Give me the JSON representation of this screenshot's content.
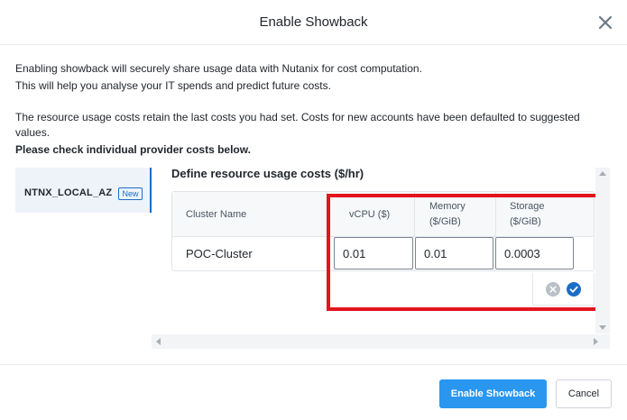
{
  "dialog": {
    "title": "Enable Showback",
    "close_icon": "close-icon"
  },
  "description": {
    "line1": "Enabling showback will securely share usage data with Nutanix for cost computation.",
    "line2": "This will help you analyse your IT spends and predict future costs.",
    "line3": "The resource usage costs retain the last costs you had set. Costs for new accounts have been defaulted to suggested",
    "line4": "values.",
    "line5": "Please check individual provider costs below."
  },
  "providers": [
    {
      "name": "NTNX_LOCAL_AZ",
      "badge": "New",
      "selected": true
    }
  ],
  "costs": {
    "heading": "Define resource usage costs ($/hr)",
    "columns": {
      "cluster": "Cluster Name",
      "vcpu": "vCPU ($)",
      "memory_line1": "Memory",
      "memory_line2": "($/GiB)",
      "storage_line1": "Storage",
      "storage_line2": "($/GiB)"
    },
    "rows": [
      {
        "cluster": "POC-Cluster",
        "vcpu": "0.01",
        "memory": "0.01",
        "storage": "0.0003"
      }
    ],
    "actions": {
      "cancel_icon": "cancel-circle-icon",
      "confirm_icon": "check-circle-icon"
    }
  },
  "colors": {
    "primary": "#2997ef",
    "accent": "#1b6dc6",
    "highlight": "#e3141e"
  },
  "footer": {
    "primary_label": "Enable Showback",
    "cancel_label": "Cancel"
  }
}
